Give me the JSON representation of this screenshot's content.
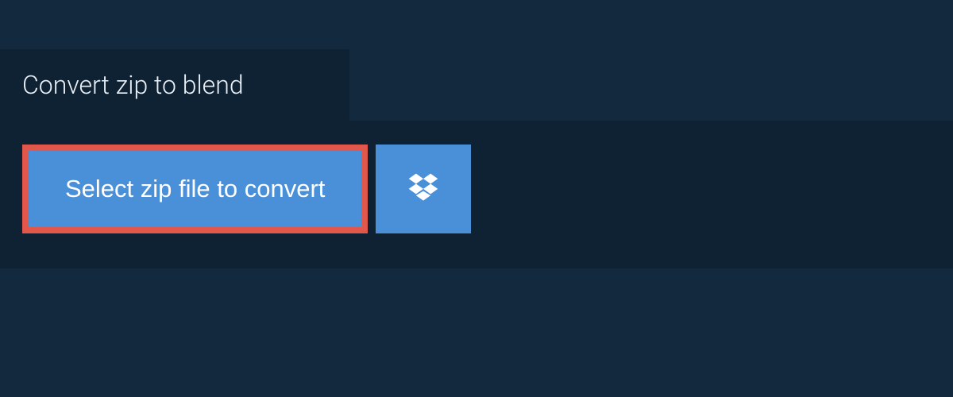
{
  "header": {
    "title": "Convert zip to blend"
  },
  "actions": {
    "select_file_label": "Select zip file to convert"
  }
}
